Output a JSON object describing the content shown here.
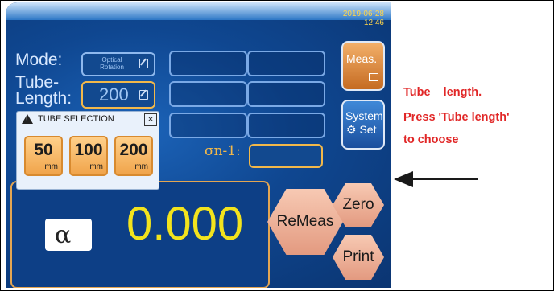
{
  "status": {
    "date": "2019-06-28",
    "time": "12:46"
  },
  "labels": {
    "mode": "Mode:",
    "tube_line1": "Tube-",
    "tube_line2": "Length:"
  },
  "mode_field": {
    "line1": "Optical",
    "line2": "Rotation"
  },
  "tube_length_field": {
    "value": "200"
  },
  "side_buttons": {
    "meas": "Meas.",
    "system_line1": "System",
    "system_line2": "Set"
  },
  "sigma_label": "σn-1:",
  "tube_popup": {
    "title": "TUBE SELECTION",
    "close": "×",
    "options": [
      {
        "value": "50",
        "unit": "mm"
      },
      {
        "value": "100",
        "unit": "mm"
      },
      {
        "value": "200",
        "unit": "mm"
      }
    ]
  },
  "measurement": {
    "symbol": "α",
    "value": "0.000"
  },
  "action_buttons": {
    "remeas": "ReMeas",
    "zero": "Zero",
    "print": "Print"
  },
  "annotation": {
    "line1": "Tube    length.",
    "line2": "Press 'Tube length'",
    "line3": "to choose"
  },
  "colors": {
    "screen": "#0f4791",
    "readout_value": "#f2e31d",
    "annotation": "#e12727",
    "tube_button": "#f0a44b"
  }
}
